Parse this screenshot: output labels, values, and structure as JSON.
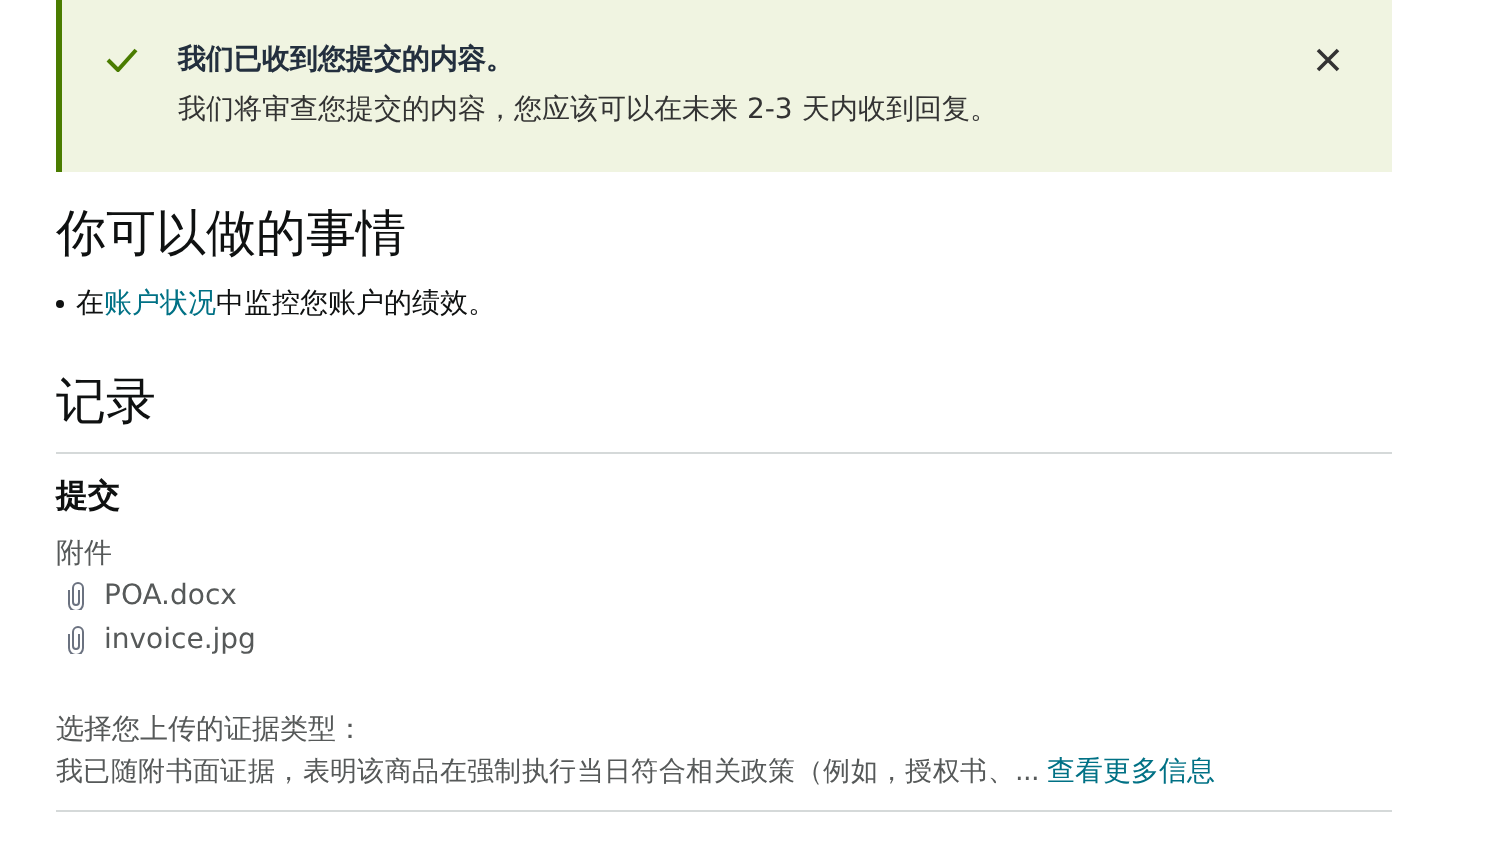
{
  "banner": {
    "title": "我们已收到您提交的内容。",
    "message": "我们将审查您提交的内容，您应该可以在未来 2-3 天内收到回复。"
  },
  "actions": {
    "heading": "你可以做的事情",
    "items": [
      {
        "before": "在",
        "link": "账户状况",
        "after": "中监控您账户的绩效。"
      }
    ]
  },
  "record": {
    "heading": "记录",
    "submission": {
      "title": "提交",
      "attachments_label": "附件",
      "attachments": [
        "POA.docx",
        "invoice.jpg"
      ],
      "evidence_label": "选择您上传的证据类型：",
      "evidence_text": "我已随附书面证据，表明该商品在强制执行当日符合相关政策（例如，授权书、...",
      "more_link": "查看更多信息"
    }
  }
}
